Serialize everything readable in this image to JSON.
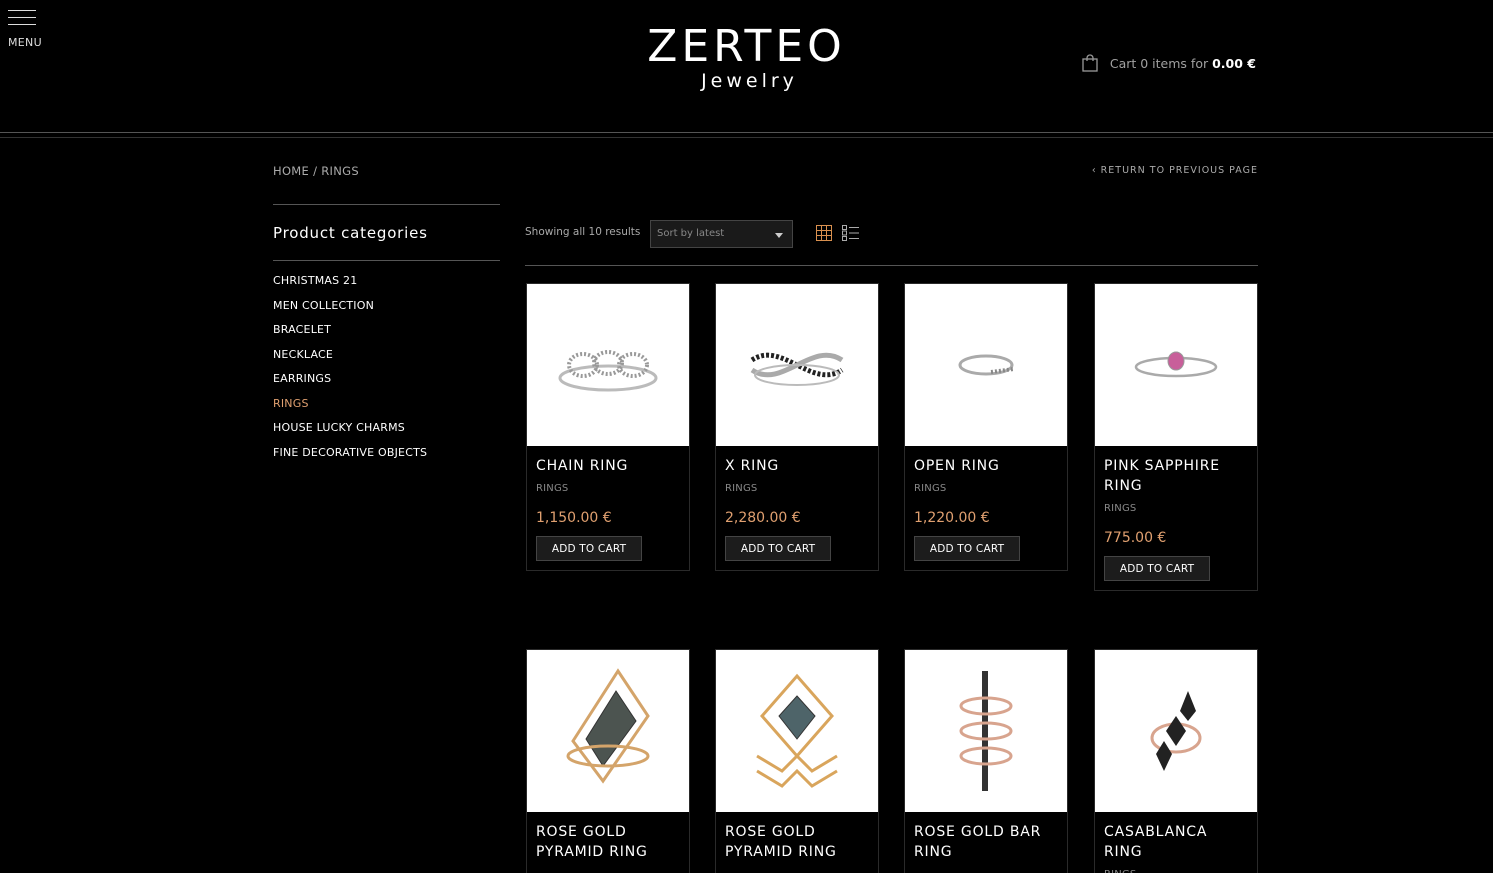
{
  "header": {
    "menu_label": "MENU",
    "logo_main": "ZERTEO",
    "logo_sub": "Jewelry",
    "cart_text": "Cart 0 items for",
    "cart_total": "0.00 €"
  },
  "breadcrumb": {
    "home": "HOME",
    "separator": "/",
    "current": "RINGS"
  },
  "return_link": "‹ RETURN TO PREVIOUS PAGE",
  "sidebar": {
    "title": "Product categories",
    "items": [
      {
        "label": "CHRISTMAS 21",
        "active": false
      },
      {
        "label": "MEN COLLECTION",
        "active": false
      },
      {
        "label": "BRACELET",
        "active": false
      },
      {
        "label": "NECKLACE",
        "active": false
      },
      {
        "label": "EARRINGS",
        "active": false
      },
      {
        "label": "RINGS",
        "active": true
      },
      {
        "label": "HOUSE LUCKY CHARMS",
        "active": false
      },
      {
        "label": "FINE DECORATIVE OBJECTS",
        "active": false
      }
    ]
  },
  "toolbar": {
    "result_count": "Showing all 10 results",
    "sort_selected": "Sort by latest"
  },
  "products": [
    {
      "name": "CHAIN RING",
      "category": "RINGS",
      "price": "1,150.00 €",
      "button": "ADD TO CART"
    },
    {
      "name": "X RING",
      "category": "RINGS",
      "price": "2,280.00 €",
      "button": "ADD TO CART"
    },
    {
      "name": "OPEN RING",
      "category": "RINGS",
      "price": "1,220.00 €",
      "button": "ADD TO CART"
    },
    {
      "name": "PINK SAPPHIRE RING",
      "category": "RINGS",
      "price": "775.00 €",
      "button": "ADD TO CART"
    },
    {
      "name": "ROSE GOLD PYRAMID RING",
      "category": "",
      "price": "",
      "button": ""
    },
    {
      "name": "ROSE GOLD PYRAMID RING",
      "category": "",
      "price": "",
      "button": ""
    },
    {
      "name": "ROSE GOLD BAR RING",
      "category": "",
      "price": "",
      "button": ""
    },
    {
      "name": "CASABLANCA RING",
      "category": "RINGS",
      "price": "",
      "button": ""
    }
  ],
  "colors": {
    "accent": "#e0a070",
    "background": "#000000"
  }
}
